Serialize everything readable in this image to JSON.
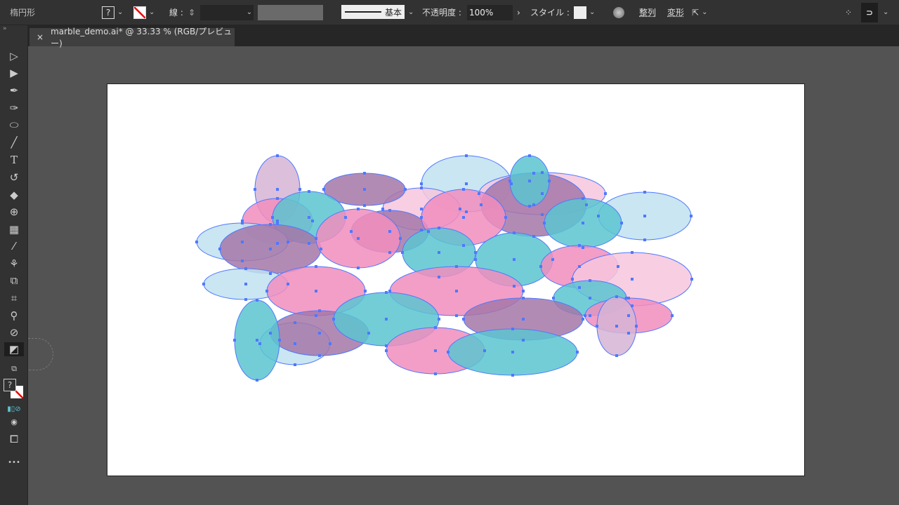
{
  "control_bar": {
    "tool_name": "楕円形",
    "fill_swatch": "?",
    "stroke_label": "線 :",
    "stroke_profile": "基本",
    "opacity_label": "不透明度 :",
    "opacity_value": "100%",
    "style_label": "スタイル :",
    "align_label": "整列",
    "transform_label": "変形"
  },
  "document_tab": {
    "close": "×",
    "title": "marble_demo.ai* @ 33.33 % (RGB/プレビュー)"
  },
  "toolbar": {
    "more": "•••",
    "fill_swatch": "?"
  },
  "colors": {
    "light_blue": "#bfe2f0",
    "pink": "#f18dbd",
    "purple": "#a577a8",
    "teal": "#5bc4d0",
    "light_pink": "#f7c6dd",
    "light_purple": "#d5b4d5",
    "selection": "#4f78ff"
  }
}
